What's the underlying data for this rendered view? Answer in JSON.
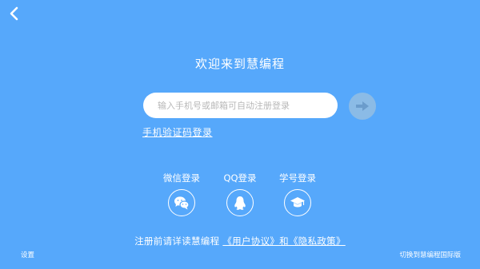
{
  "header": {
    "back_icon": "chevron-left-icon",
    "title": "欢迎来到慧编程"
  },
  "login": {
    "input_placeholder": "输入手机号或邮箱可自动注册登录",
    "input_value": "",
    "next_icon": "arrow-right-icon",
    "sms_login_label": "手机验证码登录"
  },
  "social": [
    {
      "label": "微信登录",
      "icon": "wechat-icon"
    },
    {
      "label": "QQ登录",
      "icon": "qq-icon"
    },
    {
      "label": "学号登录",
      "icon": "graduation-cap-icon"
    }
  ],
  "agreement": {
    "prefix": "注册前请详读慧编程",
    "links": "《用户协议》和《隐私政策》"
  },
  "footer": {
    "settings_label": "设置",
    "international_label": "切换到慧编程国际版"
  },
  "colors": {
    "background": "#56a8fb",
    "next_button": "#8bbbe6",
    "text": "#ffffff"
  }
}
